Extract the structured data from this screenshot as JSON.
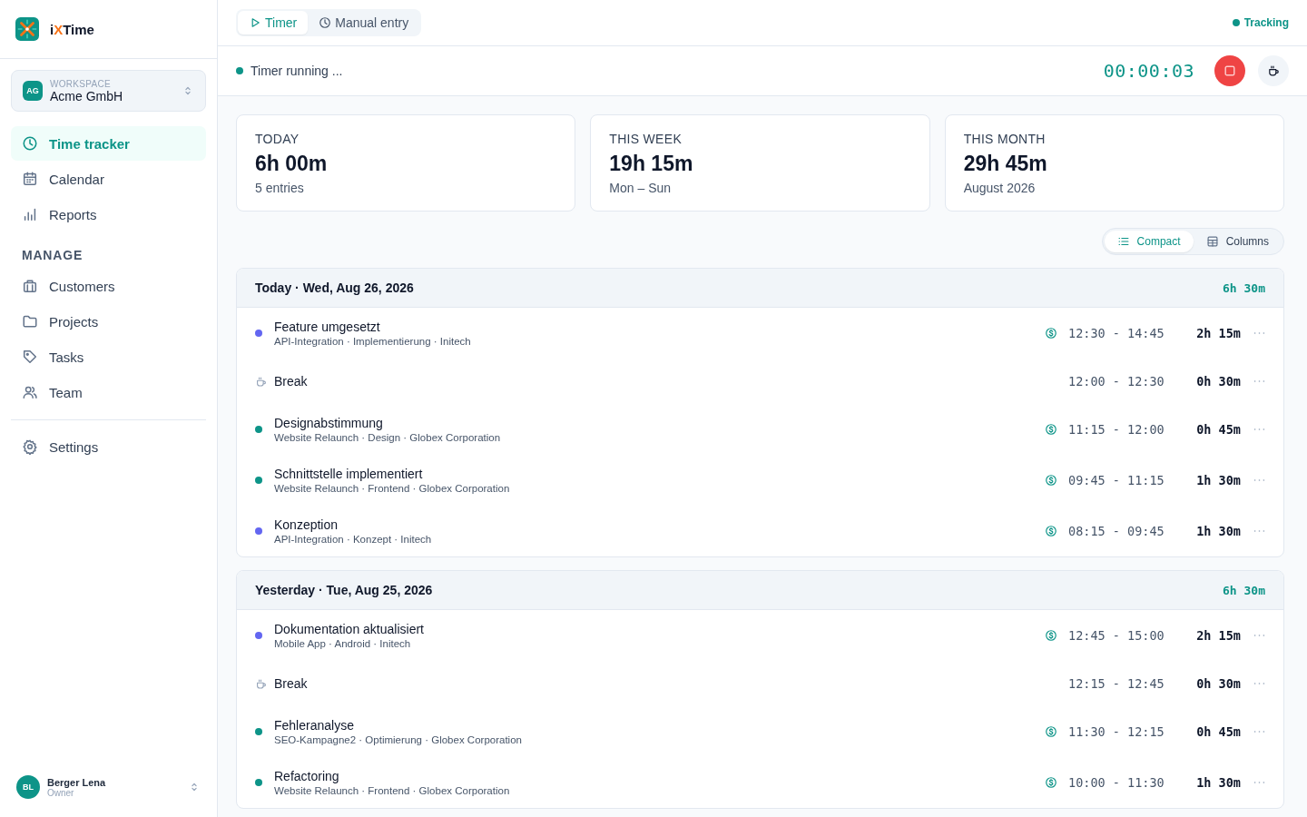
{
  "app": {
    "name_start": "i",
    "name_accent": "X",
    "name_end": "Time"
  },
  "workspace": {
    "label": "WORKSPACE",
    "initials": "AG",
    "name": "Acme GmbH"
  },
  "nav": [
    {
      "label": "Time tracker",
      "selected": true
    },
    {
      "label": "Calendar",
      "selected": false
    },
    {
      "label": "Reports",
      "selected": false
    }
  ],
  "manage": {
    "heading": "MANAGE",
    "items": [
      {
        "label": "Customers",
        "selected": false
      },
      {
        "label": "Projects",
        "selected": false
      },
      {
        "label": "Tasks",
        "selected": false
      },
      {
        "label": "Team",
        "selected": false
      }
    ]
  },
  "settings": {
    "label": "Settings",
    "selected": false
  },
  "user": {
    "initials": "BL",
    "name": "Berger Lena",
    "role": "Owner"
  },
  "tabs": [
    {
      "label": "Timer",
      "selected": true
    },
    {
      "label": "Manual entry",
      "selected": false
    }
  ],
  "tracking_status": "Tracking",
  "timer": {
    "status": "Timer running ...",
    "elapsed": "00:00:03"
  },
  "stats": [
    {
      "label": "TODAY",
      "value": "6h 00m",
      "sub": "5 entries"
    },
    {
      "label": "THIS WEEK",
      "value": "19h 15m",
      "sub": "Mon – Sun"
    },
    {
      "label": "THIS MONTH",
      "value": "29h 45m",
      "sub": "August 2026"
    }
  ],
  "view_toggle": [
    {
      "label": "Compact",
      "selected": true
    },
    {
      "label": "Columns",
      "selected": false
    }
  ],
  "groups": [
    {
      "title": "Today · Wed, Aug 26, 2026",
      "total": "6h 30m",
      "entries": [
        {
          "kind": "task",
          "title": "Feature umgesetzt",
          "meta": "API-Integration · Implementierung · Initech",
          "color": "#6366f1",
          "billable": true,
          "range": "12:30 - 14:45",
          "duration": "2h 15m"
        },
        {
          "kind": "break",
          "title": "Break",
          "range": "12:00 - 12:30",
          "duration": "0h 30m"
        },
        {
          "kind": "task",
          "title": "Designabstimmung",
          "meta": "Website Relaunch · Design · Globex Corporation",
          "color": "#0d9488",
          "billable": true,
          "range": "11:15 - 12:00",
          "duration": "0h 45m"
        },
        {
          "kind": "task",
          "title": "Schnittstelle implementiert",
          "meta": "Website Relaunch · Frontend · Globex Corporation",
          "color": "#0d9488",
          "billable": true,
          "range": "09:45 - 11:15",
          "duration": "1h 30m"
        },
        {
          "kind": "task",
          "title": "Konzeption",
          "meta": "API-Integration · Konzept · Initech",
          "color": "#6366f1",
          "billable": true,
          "range": "08:15 - 09:45",
          "duration": "1h 30m"
        }
      ]
    },
    {
      "title": "Yesterday · Tue, Aug 25, 2026",
      "total": "6h 30m",
      "entries": [
        {
          "kind": "task",
          "title": "Dokumentation aktualisiert",
          "meta": "Mobile App · Android · Initech",
          "color": "#6366f1",
          "billable": true,
          "range": "12:45 - 15:00",
          "duration": "2h 15m"
        },
        {
          "kind": "break",
          "title": "Break",
          "range": "12:15 - 12:45",
          "duration": "0h 30m"
        },
        {
          "kind": "task",
          "title": "Fehleranalyse",
          "meta": "SEO-Kampagne2 · Optimierung · Globex Corporation",
          "color": "#0d9488",
          "billable": true,
          "range": "11:30 - 12:15",
          "duration": "0h 45m"
        },
        {
          "kind": "task",
          "title": "Refactoring",
          "meta": "Website Relaunch · Frontend · Globex Corporation",
          "color": "#0d9488",
          "billable": true,
          "range": "10:00 - 11:30",
          "duration": "1h 30m"
        }
      ]
    }
  ]
}
